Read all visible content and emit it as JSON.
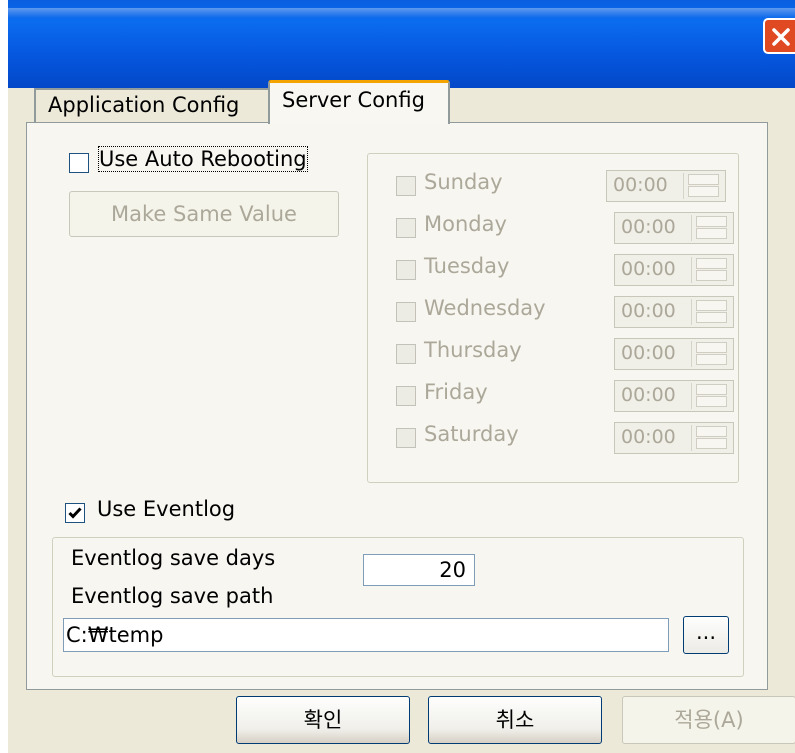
{
  "window": {
    "title": ""
  },
  "tabs": [
    {
      "label": "Application Config",
      "active": false
    },
    {
      "label": "Server Config",
      "active": true
    }
  ],
  "auto_reboot": {
    "label": "Use Auto Rebooting",
    "checked": false,
    "make_same_label": "Make Same Value",
    "days": [
      {
        "label": "Sunday",
        "time": "00:00",
        "checked": false
      },
      {
        "label": "Monday",
        "time": "00:00",
        "checked": false
      },
      {
        "label": "Tuesday",
        "time": "00:00",
        "checked": false
      },
      {
        "label": "Wednesday",
        "time": "00:00",
        "checked": false
      },
      {
        "label": "Thursday",
        "time": "00:00",
        "checked": false
      },
      {
        "label": "Friday",
        "time": "00:00",
        "checked": false
      },
      {
        "label": "Saturday",
        "time": "00:00",
        "checked": false
      }
    ]
  },
  "eventlog": {
    "label": "Use Eventlog",
    "checked": true,
    "save_days_label": "Eventlog save days",
    "save_days_value": "20",
    "save_path_label": "Eventlog save path",
    "save_path_value": "C:₩temp",
    "browse_label": "..."
  },
  "buttons": {
    "ok": "확인",
    "cancel": "취소",
    "apply": "적용(A)"
  },
  "colors": {
    "titlebar": "#0658e0",
    "close": "#e04a23",
    "tab_highlight": "#f5a300",
    "dialog_bg": "#ece9d8",
    "disabled_text": "#aca899"
  }
}
